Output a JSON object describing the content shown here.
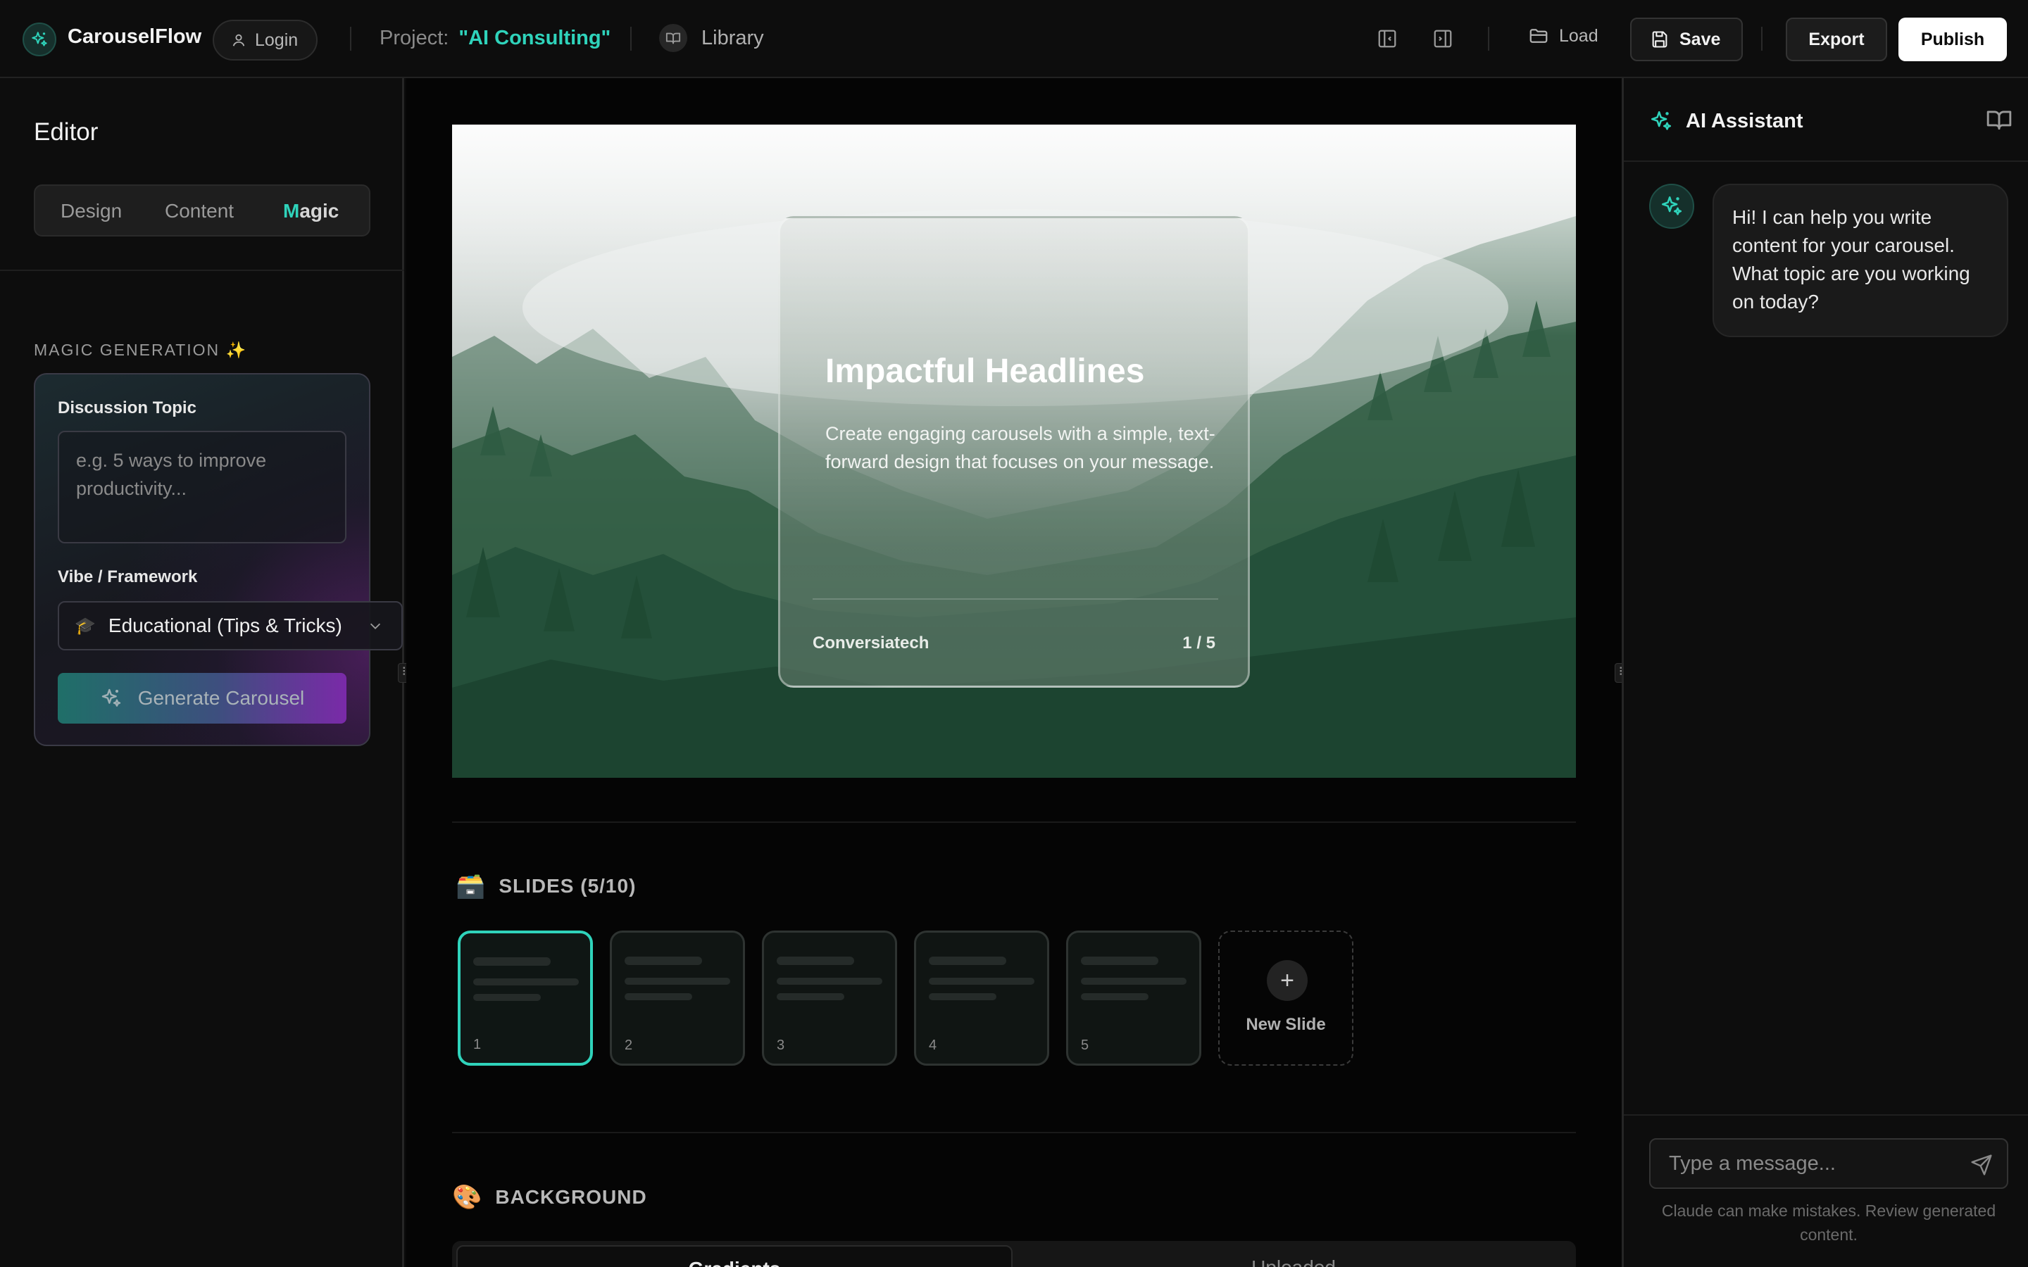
{
  "app": {
    "name": "CarouselFlow",
    "login_label": "Login",
    "project_label": "Project:",
    "project_name": "\"AI Consulting\"",
    "library_label": "Library",
    "load_label": "Load",
    "save_label": "Save",
    "export_label": "Export",
    "publish_label": "Publish",
    "accent_color": "#2fd3bb"
  },
  "icons": {
    "logo": "sparkle-icon",
    "login": "user-icon",
    "library": "book-icon",
    "left_panel": "panel-left-icon",
    "right_panel": "panel-right-icon",
    "load": "folder-icon",
    "save": "save-icon",
    "generate": "sparkle-icon",
    "send": "send-icon"
  },
  "editor": {
    "title": "Editor",
    "tabs": [
      {
        "label": "Design",
        "active": false
      },
      {
        "label": "Content",
        "active": false
      },
      {
        "label": "Magic",
        "active": true
      }
    ],
    "magic_heading": "MAGIC GENERATION ✨",
    "topic_label": "Discussion Topic",
    "topic_placeholder": "e.g. 5 ways to improve productivity...",
    "vibe_label": "Vibe / Framework",
    "vibe_emoji": "🎓",
    "vibe_value": "Educational (Tips & Tricks)",
    "generate_label": "Generate Carousel"
  },
  "slide": {
    "title": "Impactful Headlines",
    "body": "Create engaging carousels with a simple, text-forward design that focuses on your message.",
    "brand": "Conversiatech",
    "page": "1 / 5"
  },
  "slides": {
    "heading_emoji": "🗃️",
    "heading": "SLIDES (5/10)",
    "items": [
      {
        "number": "1",
        "active": true
      },
      {
        "number": "2",
        "active": false
      },
      {
        "number": "3",
        "active": false
      },
      {
        "number": "4",
        "active": false
      },
      {
        "number": "5",
        "active": false
      }
    ],
    "new_label": "New Slide"
  },
  "background": {
    "heading_emoji": "🎨",
    "heading": "BACKGROUND",
    "tabs": [
      {
        "label": "Gradients",
        "active": true
      },
      {
        "label": "Uploaded",
        "active": false
      }
    ]
  },
  "assistant": {
    "title": "AI Assistant",
    "message": "Hi! I can help you write content for your carousel. What topic are you working on today?",
    "input_placeholder": "Type a message...",
    "disclaimer": "Claude can make mistakes. Review generated content."
  }
}
